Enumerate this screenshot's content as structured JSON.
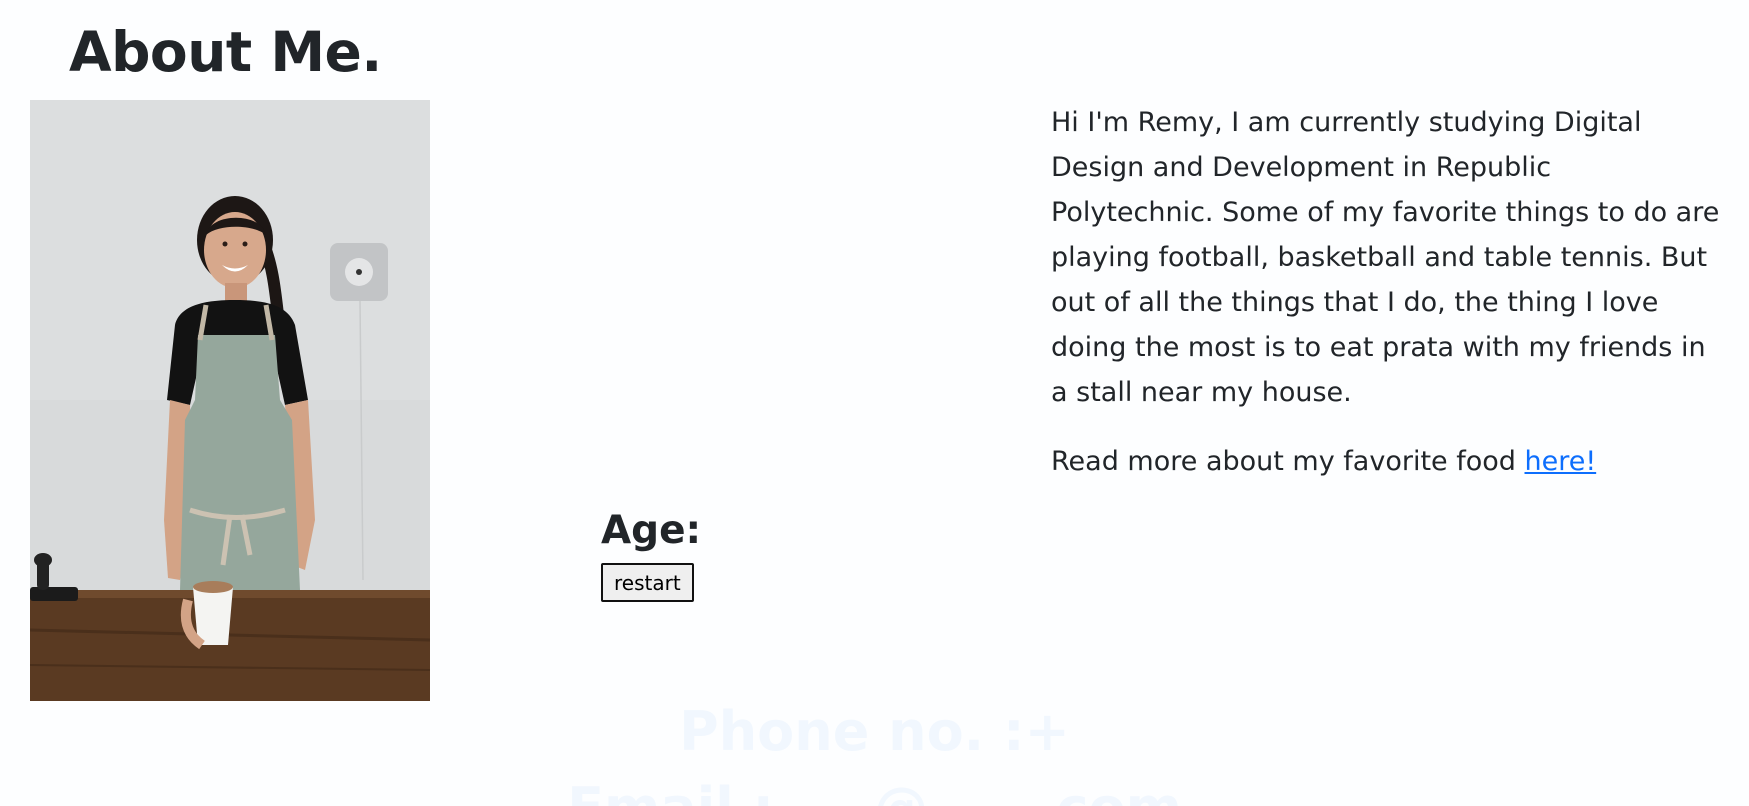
{
  "page": {
    "title": "About Me."
  },
  "photo": {
    "alt": "Smiling woman in apron holding a coffee cup at a wooden table"
  },
  "age": {
    "label": "Age:",
    "restart_label": "restart"
  },
  "bio": {
    "paragraph": "Hi I'm Remy, I am currently studying Digital Design and Development in Republic Polytechnic. Some of my favorite things to do are playing football, basketball and table tennis. But out of all the things that I do, the thing I love doing the most is to eat prata with my friends in a stall near my house.",
    "readmore_text": "Read more about my favorite food ",
    "readmore_link": "here!"
  },
  "contact": {
    "phone_label": "Phone no. :+",
    "email_label": "Email : ___@____.com"
  },
  "colors": {
    "link": "#0d6efd",
    "text": "#212529",
    "faded": "#f1f7fe"
  }
}
